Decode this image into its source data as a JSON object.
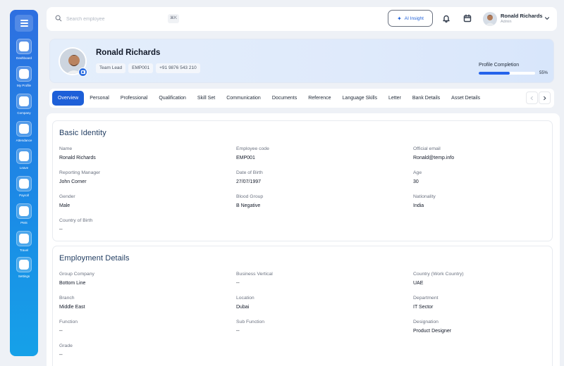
{
  "sidebar": {
    "items": [
      {
        "label": "Dashboard",
        "icon": "dashboard-icon"
      },
      {
        "label": "My Profile",
        "icon": "profile-icon"
      },
      {
        "label": "Company",
        "icon": "company-icon"
      },
      {
        "label": "Attendance",
        "icon": "attendance-icon"
      },
      {
        "label": "Leave",
        "icon": "leave-icon"
      },
      {
        "label": "Payroll",
        "icon": "payroll-icon"
      },
      {
        "label": "PMS",
        "icon": "pms-icon"
      },
      {
        "label": "Travel",
        "icon": "travel-icon"
      },
      {
        "label": "Settings",
        "icon": "settings-icon"
      }
    ]
  },
  "topbar": {
    "search_placeholder": "Search employee",
    "shortcut": "⌘K",
    "ai_label": "AI Insight",
    "user_name": "Ronald Richards",
    "user_role": "Admin"
  },
  "profile": {
    "name": "Ronald Richards",
    "chips": [
      "Team Lead",
      "EMP001",
      "+91 9876 543 210"
    ],
    "completion_label": "Profile Completion",
    "completion_value": "55%",
    "completion_fraction": 0.55
  },
  "tabs": [
    "Overview",
    "Personal",
    "Professional",
    "Qualification",
    "Skill Set",
    "Communication",
    "Documents",
    "Reference",
    "Language Skills",
    "Letter",
    "Bank Details",
    "Asset Details"
  ],
  "active_tab": "Overview",
  "basic_identity": {
    "title": "Basic Identity",
    "fields": [
      {
        "label": "Name",
        "value": "Ronald Richards"
      },
      {
        "label": "Employee code",
        "value": "EMP001"
      },
      {
        "label": "Official email",
        "value": "Ronald@temp.info"
      },
      {
        "label": "Reporting Manager",
        "value": "John Corner"
      },
      {
        "label": "Date of Birth",
        "value": "27/07/1997"
      },
      {
        "label": "Age",
        "value": "30"
      },
      {
        "label": "Gender",
        "value": "Male"
      },
      {
        "label": "Blood Group",
        "value": "B Negative"
      },
      {
        "label": "Nationality",
        "value": "India"
      },
      {
        "label": "Country of Birth",
        "value": "--"
      }
    ]
  },
  "employment_details": {
    "title": "Employment Details",
    "fields": [
      {
        "label": "Group Company",
        "value": "Bottom Line"
      },
      {
        "label": "Business Vertical",
        "value": "--"
      },
      {
        "label": "Country (Work Country)",
        "value": "UAE"
      },
      {
        "label": "Branch",
        "value": "Middle East"
      },
      {
        "label": "Location",
        "value": "Dubai"
      },
      {
        "label": "Department",
        "value": "IT Sector"
      },
      {
        "label": "Function",
        "value": "--"
      },
      {
        "label": "Sub Function",
        "value": "--"
      },
      {
        "label": "Designation",
        "value": "Product Designer"
      },
      {
        "label": "Grade",
        "value": "--"
      }
    ]
  },
  "colors": {
    "accent": "#1d5fd8",
    "sidebar_top": "#2e6fe0",
    "sidebar_bottom": "#16a1e8",
    "title": "#1e3a5f"
  }
}
